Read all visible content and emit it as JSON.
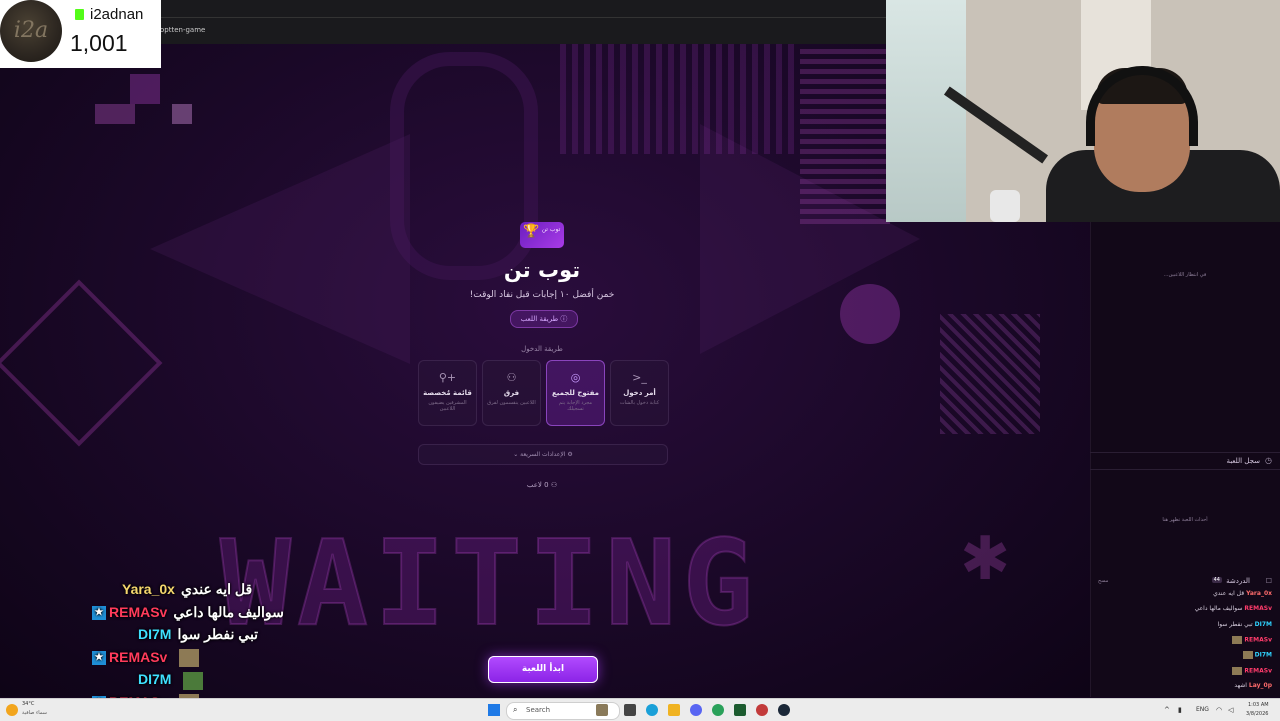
{
  "browser": {
    "url_fragment": "optten-game"
  },
  "overlay": {
    "streamer_name": "i2adnan",
    "follower_count": "1,001",
    "avatar_text": "i2a"
  },
  "game": {
    "logo_label": "توب تن",
    "title": "توب تن",
    "subtitle": "خمن أفضل ١٠ إجابات قبل نفاد الوقت!",
    "how_to_play": "طريقة اللعب",
    "login_method_label": "طريقة الدخول",
    "modes": [
      {
        "title": "أمر دخول",
        "desc": "كتابة دخول بالشات",
        "icon": ">_"
      },
      {
        "title": "مفتوح للجميع",
        "desc": "مجرد الإجابة يتم تسجيلك",
        "icon": "globe"
      },
      {
        "title": "فرق",
        "desc": "اللاعبين ينقسمون لفرق",
        "icon": "users"
      },
      {
        "title": "قائمة مُخصصة",
        "desc": "المشرفين يضيفون اللاعبين",
        "icon": "user-plus"
      }
    ],
    "quick_settings": "الإعدادات السريعة",
    "players_count": "0 لاعب",
    "start_button": "ابدأ اللعبة",
    "background_word": "WAITING"
  },
  "sidebar": {
    "waiting_players": "في انتظار اللاعبين...",
    "game_log_title": "سجل اللعبة",
    "game_log_empty": "أحداث اللعبة تظهر هنا",
    "chat_title": "الدردشة",
    "chat_count": "44",
    "chat_clear": "مسح",
    "chat_rows": [
      {
        "user": "Yara_0x",
        "message": "قل ايه عندي",
        "color": "#ff6b6b"
      },
      {
        "user": "REMASv",
        "message": "سواليف مالها داعي",
        "color": "#ff3b6b"
      },
      {
        "user": "DI7M",
        "message": "تبي نفطر سوا",
        "color": "#2fd3ff"
      },
      {
        "user": "REMASv",
        "message": "",
        "color": "#ff3b6b"
      },
      {
        "user": "DI7M",
        "message": "",
        "color": "#2fd3ff"
      },
      {
        "user": "REMASv",
        "message": "",
        "color": "#ff3b6b"
      },
      {
        "user": "Lay_0p",
        "message": "اشهد",
        "color": "#ff6b6b"
      }
    ]
  },
  "stream_chat": [
    {
      "user": "Yara_0x",
      "message": "قل ايه عندي",
      "color": "#f5d76e",
      "badge": false,
      "emote": false
    },
    {
      "user": "REMASv",
      "message": "سواليف مالها داعي",
      "color": "#ff3b5c",
      "badge": true,
      "emote": false
    },
    {
      "user": "DI7M",
      "message": "تبي نفطر سوا",
      "color": "#3fe0ff",
      "badge": false,
      "emote": false
    },
    {
      "user": "REMASv",
      "message": "",
      "color": "#ff3b5c",
      "badge": true,
      "emote": true
    },
    {
      "user": "DI7M",
      "message": "",
      "color": "#3fe0ff",
      "badge": false,
      "emote": true
    },
    {
      "user": "REMASv",
      "message": "",
      "color": "#ff3b5c",
      "badge": true,
      "emote": true
    }
  ],
  "taskbar": {
    "weather_temp": "34°C",
    "weather_desc": "سماء صافية",
    "search_label": "Search",
    "language": "ENG",
    "time": "1:03 AM",
    "date": "3/8/2026"
  }
}
